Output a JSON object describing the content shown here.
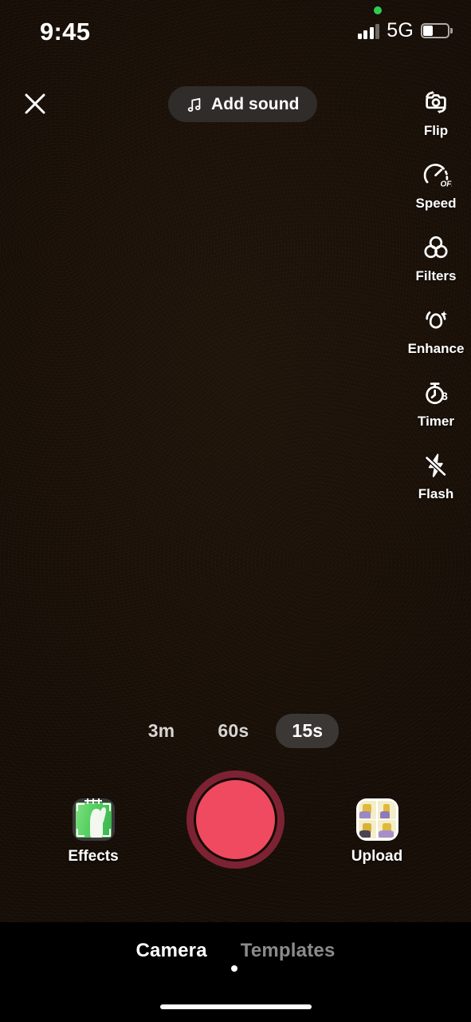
{
  "status_bar": {
    "time": "9:45",
    "network": "5G",
    "signal_bars_active": 3,
    "battery_percent": 40,
    "recording_indicator": "green-dot"
  },
  "header": {
    "close_label": "Close",
    "add_sound_label": "Add sound",
    "add_sound_icon": "music-note-icon"
  },
  "tool_rail": {
    "items": [
      {
        "label": "Flip",
        "icon": "camera-flip-icon"
      },
      {
        "label": "Speed",
        "icon": "speedometer-icon",
        "badge": "OFF"
      },
      {
        "label": "Filters",
        "icon": "filters-circles-icon"
      },
      {
        "label": "Enhance",
        "icon": "enhance-sparkle-icon"
      },
      {
        "label": "Timer",
        "icon": "stopwatch-icon",
        "badge": "3"
      },
      {
        "label": "Flash",
        "icon": "flash-off-icon"
      }
    ]
  },
  "duration_selector": {
    "options": [
      {
        "label": "3m",
        "selected": false
      },
      {
        "label": "60s",
        "selected": false
      },
      {
        "label": "15s",
        "selected": true
      }
    ]
  },
  "capture": {
    "record_label": "Record",
    "effects_label": "Effects",
    "effects_icon": "effects-thumbnail",
    "upload_label": "Upload",
    "upload_icon": "upload-gallery-thumbnail"
  },
  "bottom_tabs": {
    "items": [
      {
        "label": "Camera",
        "active": true
      },
      {
        "label": "Templates",
        "active": false
      }
    ]
  },
  "colors": {
    "record_inner": "#ef4a5f",
    "record_ring": "#7d2233",
    "viewfinder": "#190f07",
    "pill_bg": "#2f2c2a",
    "selected_pill": "#3a3734",
    "inactive_tab": "#8b8b8b",
    "status_green": "#2fcc52"
  }
}
